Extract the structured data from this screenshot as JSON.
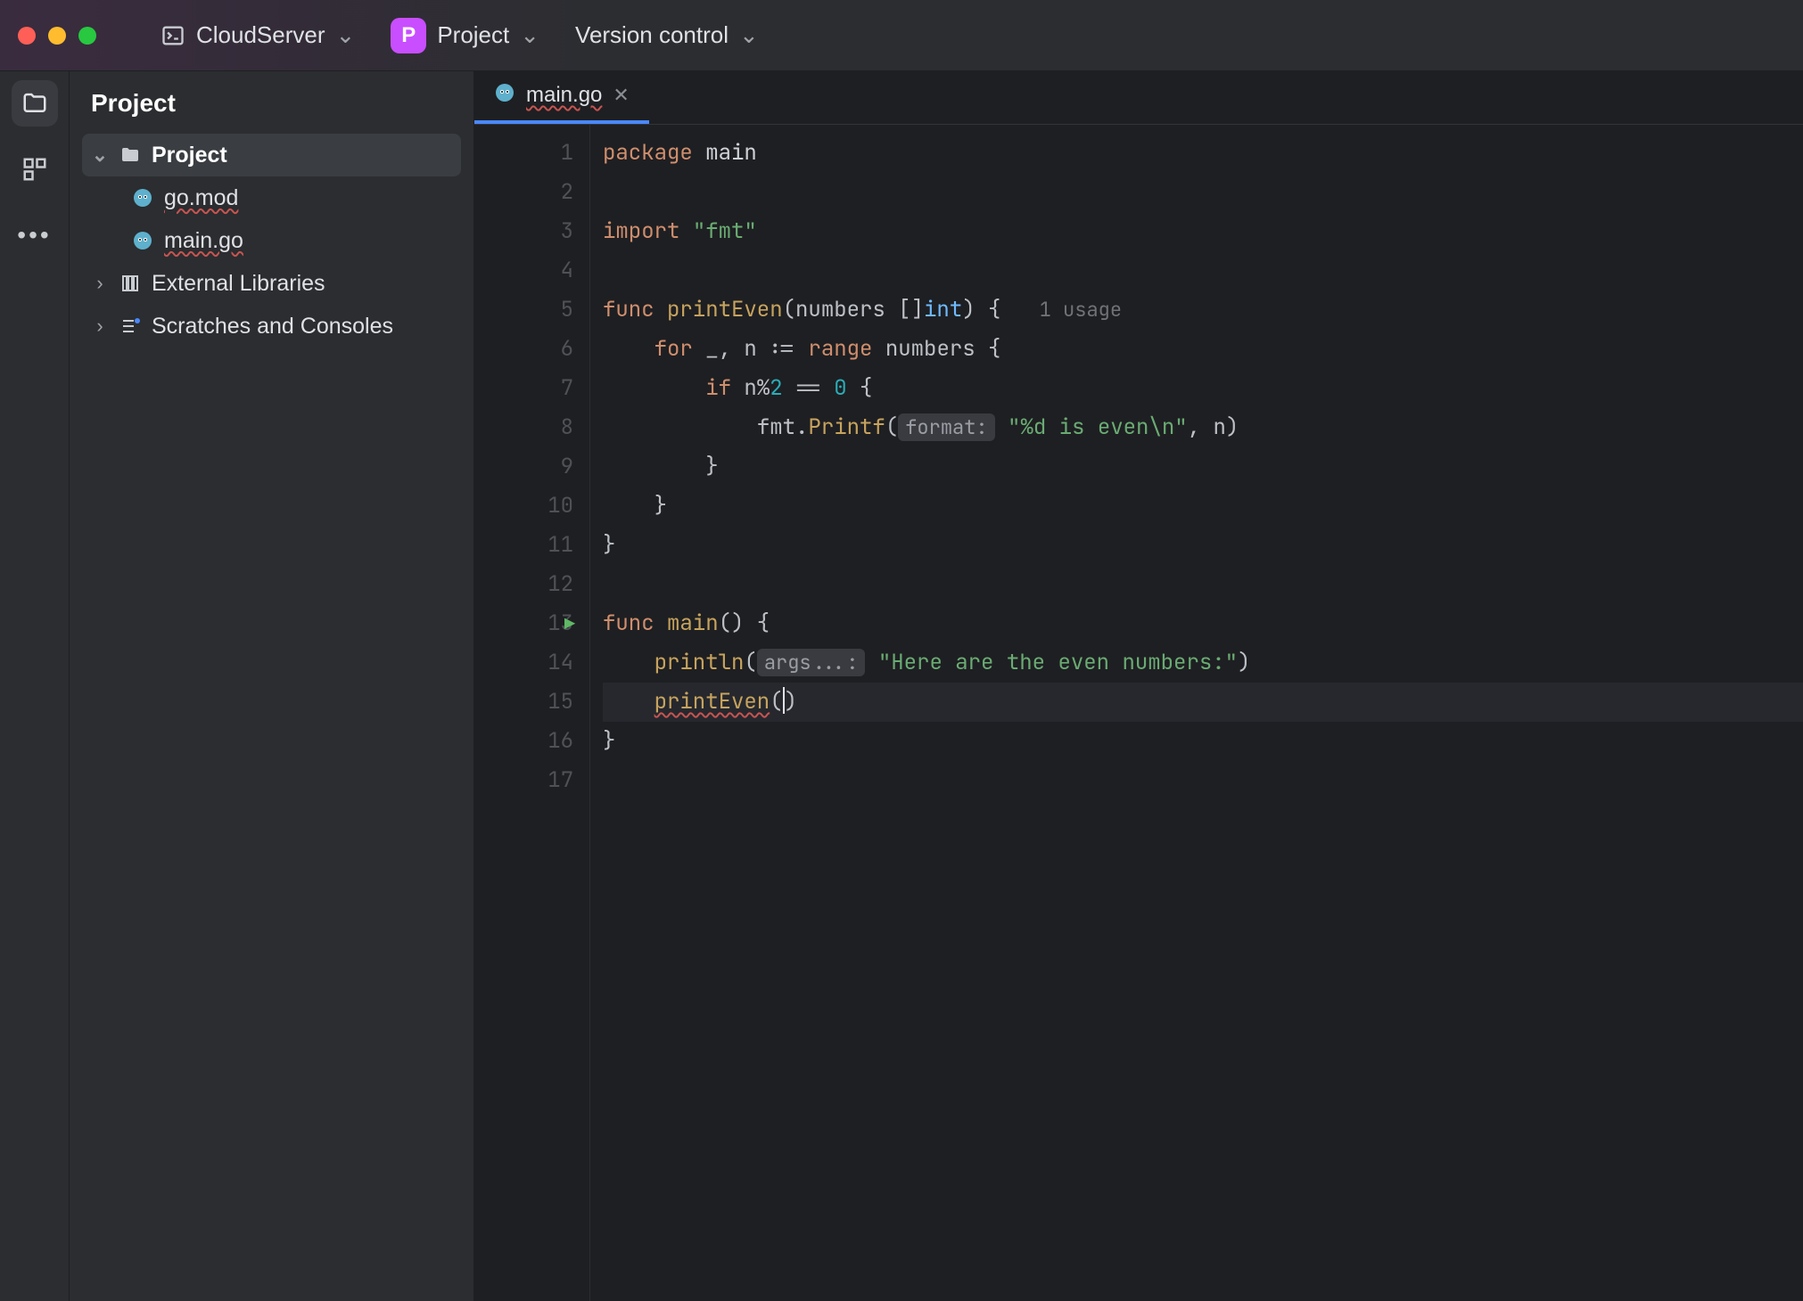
{
  "titlebar": {
    "cloud_label": "CloudServer",
    "project_label": "Project",
    "project_badge": "P",
    "vcs_label": "Version control"
  },
  "panel": {
    "title": "Project",
    "root": "Project",
    "files": [
      "go.mod",
      "main.go"
    ],
    "external": "External Libraries",
    "scratches": "Scratches and Consoles"
  },
  "tab": {
    "filename": "main.go"
  },
  "code": {
    "usages_hint": "1 usage",
    "run_line": 13,
    "current_line": 15,
    "lines": [
      {
        "n": 1,
        "tokens": [
          {
            "t": "package ",
            "c": "kw"
          },
          {
            "t": "main",
            "c": "pkg"
          }
        ]
      },
      {
        "n": 2,
        "tokens": []
      },
      {
        "n": 3,
        "tokens": [
          {
            "t": "import ",
            "c": "kw"
          },
          {
            "t": "\"fmt\"",
            "c": "str"
          }
        ]
      },
      {
        "n": 4,
        "tokens": []
      },
      {
        "n": 5,
        "tokens": [
          {
            "t": "func ",
            "c": "kw"
          },
          {
            "t": "printEven",
            "c": "fn"
          },
          {
            "t": "(",
            "c": "plain"
          },
          {
            "t": "numbers ",
            "c": "plain"
          },
          {
            "t": "[]",
            "c": "plain"
          },
          {
            "t": "int",
            "c": "typ"
          },
          {
            "t": ") {",
            "c": "plain"
          }
        ],
        "inlay_after": "1 usage"
      },
      {
        "n": 6,
        "tokens": [
          {
            "t": "    for ",
            "c": "kw"
          },
          {
            "t": "_",
            "c": "plain"
          },
          {
            "t": ", ",
            "c": "plain"
          },
          {
            "t": "n ",
            "c": "plain"
          },
          {
            "t": ":= ",
            "c": "plain"
          },
          {
            "t": "range ",
            "c": "kw"
          },
          {
            "t": "numbers ",
            "c": "plain"
          },
          {
            "t": "{",
            "c": "plain"
          }
        ]
      },
      {
        "n": 7,
        "tokens": [
          {
            "t": "        if ",
            "c": "kw"
          },
          {
            "t": "n",
            "c": "plain"
          },
          {
            "t": "%",
            "c": "plain"
          },
          {
            "t": "2",
            "c": "num"
          },
          {
            "t": " == ",
            "c": "plain"
          },
          {
            "t": "0",
            "c": "num"
          },
          {
            "t": " {",
            "c": "plain"
          }
        ]
      },
      {
        "n": 8,
        "tokens": [
          {
            "t": "            ",
            "c": "plain"
          },
          {
            "t": "fmt",
            "c": "plain"
          },
          {
            "t": ".",
            "c": "plain"
          },
          {
            "t": "Printf",
            "c": "call"
          },
          {
            "t": "(",
            "c": "plain"
          },
          {
            "t": "format:",
            "c": "hint"
          },
          {
            "t": " ",
            "c": "plain"
          },
          {
            "t": "\"%d is even\\n\"",
            "c": "str"
          },
          {
            "t": ", n)",
            "c": "plain"
          }
        ]
      },
      {
        "n": 9,
        "tokens": [
          {
            "t": "        }",
            "c": "plain"
          }
        ]
      },
      {
        "n": 10,
        "tokens": [
          {
            "t": "    }",
            "c": "plain"
          }
        ]
      },
      {
        "n": 11,
        "tokens": [
          {
            "t": "}",
            "c": "plain"
          }
        ]
      },
      {
        "n": 12,
        "tokens": []
      },
      {
        "n": 13,
        "tokens": [
          {
            "t": "func ",
            "c": "kw"
          },
          {
            "t": "main",
            "c": "fn"
          },
          {
            "t": "() {",
            "c": "plain"
          }
        ]
      },
      {
        "n": 14,
        "tokens": [
          {
            "t": "    ",
            "c": "plain"
          },
          {
            "t": "println",
            "c": "call"
          },
          {
            "t": "(",
            "c": "plain"
          },
          {
            "t": "args...:",
            "c": "hint"
          },
          {
            "t": " ",
            "c": "plain"
          },
          {
            "t": "\"Here are the even numbers:\"",
            "c": "str"
          },
          {
            "t": ")",
            "c": "plain"
          }
        ]
      },
      {
        "n": 15,
        "tokens": [
          {
            "t": "    ",
            "c": "plain"
          },
          {
            "t": "printEven",
            "c": "call",
            "err": true
          },
          {
            "t": "(",
            "c": "plain"
          },
          {
            "cursor": true
          },
          {
            "t": ")",
            "c": "plain"
          }
        ]
      },
      {
        "n": 16,
        "tokens": [
          {
            "t": "}",
            "c": "plain"
          }
        ]
      },
      {
        "n": 17,
        "tokens": []
      }
    ]
  }
}
